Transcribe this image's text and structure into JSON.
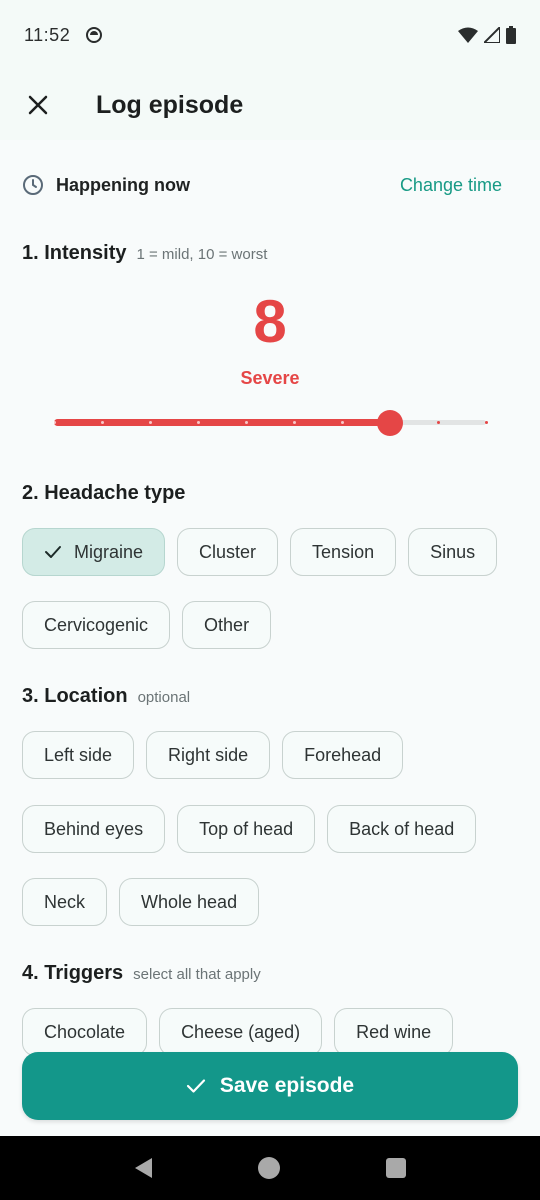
{
  "status_bar": {
    "time": "11:52"
  },
  "app_bar": {
    "title": "Log episode",
    "close_icon": "close-icon"
  },
  "time_row": {
    "label": "Happening now",
    "action": "Change time",
    "icon": "clock-icon"
  },
  "intensity": {
    "title": "1. Intensity",
    "hint": "1 = mild, 10 = worst",
    "value": "8",
    "level_label": "Severe",
    "slider": {
      "min": 1,
      "max": 10,
      "value": 8
    },
    "color": "#e54646"
  },
  "headache_type": {
    "title": "2. Headache type",
    "options": [
      "Migraine",
      "Cluster",
      "Tension",
      "Sinus",
      "Cervicogenic",
      "Other"
    ],
    "selected": "Migraine"
  },
  "location": {
    "title": "3. Location",
    "hint": "optional",
    "options": [
      "Left side",
      "Right side",
      "Forehead",
      "Behind eyes",
      "Top of head",
      "Back of head",
      "Neck",
      "Whole head"
    ]
  },
  "triggers": {
    "title": "4. Triggers",
    "hint": "select all that apply",
    "options": [
      "Chocolate",
      "Cheese (aged)",
      "Red wine"
    ]
  },
  "save_button": {
    "label": "Save episode",
    "color": "#13978a"
  },
  "colors": {
    "accent": "#179a85",
    "severe": "#e54646",
    "chip_selected": "#d3ebe6"
  }
}
